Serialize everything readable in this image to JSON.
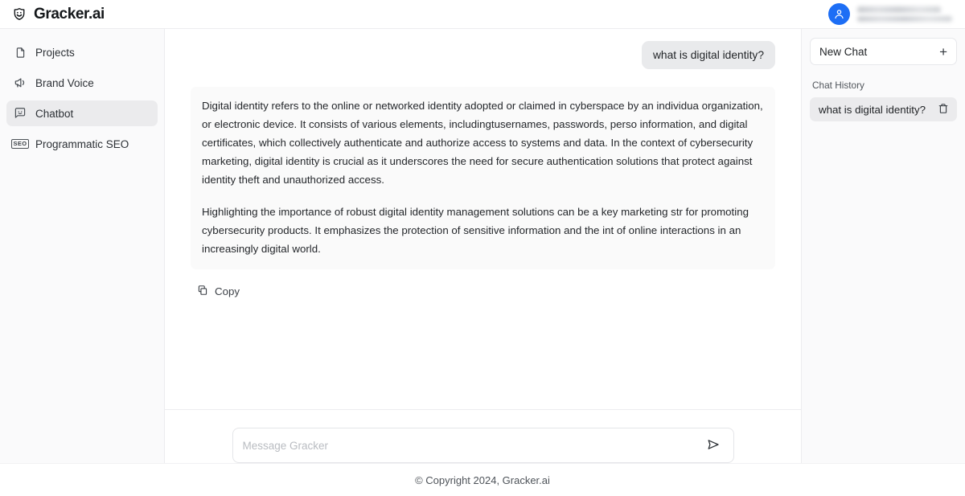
{
  "brand": {
    "name": "Gracker.ai",
    "logo_icon": "shield-smiley-icon"
  },
  "user": {
    "avatar_icon": "user-avatar-icon",
    "name_redacted": true,
    "email_redacted": true,
    "avatar_color": "#1d6ef5"
  },
  "sidebar": {
    "items": [
      {
        "label": "Projects",
        "icon": "document-icon",
        "active": false
      },
      {
        "label": "Brand Voice",
        "icon": "megaphone-icon",
        "active": false
      },
      {
        "label": "Chatbot",
        "icon": "chat-smiley-icon",
        "active": true
      },
      {
        "label": "Programmatic SEO",
        "icon": "seo-icon",
        "active": false
      }
    ]
  },
  "chat": {
    "user_message": "what is digital identity?",
    "assistant_paragraphs": [
      "Digital identity refers to the online or networked identity adopted or claimed in cyberspace by an individua organization, or electronic device. It consists of various elements, includingtusernames, passwords, perso information, and digital certificates, which collectively authenticate and authorize access to systems and data. In the context of cybersecurity marketing, digital identity is crucial as it underscores the need for secure authentication solutions that protect against identity theft and unauthorized access.",
      "Highlighting the importance of robust digital identity management solutions can be a key marketing str for promoting cybersecurity products. It emphasizes the protection of sensitive information and the int of online interactions in an increasingly digital world."
    ],
    "copy_label": "Copy",
    "copy_icon": "clipboard-copy-icon"
  },
  "composer": {
    "placeholder": "Message Gracker",
    "value": "",
    "send_icon": "send-plane-icon"
  },
  "right_panel": {
    "new_chat_label": "New Chat",
    "new_chat_icon": "plus-icon",
    "history_label": "Chat History",
    "history_items": [
      {
        "title": "what is digital identity?",
        "delete_icon": "trash-icon"
      }
    ]
  },
  "footer": {
    "copyright": "© Copyright 2024, Gracker.ai"
  }
}
